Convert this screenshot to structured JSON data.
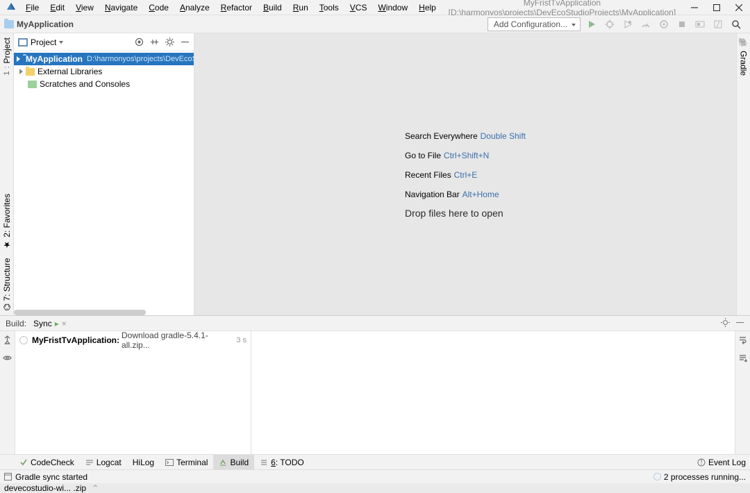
{
  "menubar": {
    "items": [
      "File",
      "Edit",
      "View",
      "Navigate",
      "Code",
      "Analyze",
      "Refactor",
      "Build",
      "Run",
      "Tools",
      "VCS",
      "Window",
      "Help"
    ],
    "title": "MyFristTvApplication [D:\\harmonyos\\projects\\DevEcoStudioProjects\\MyApplication]"
  },
  "navbar": {
    "name": "MyApplication",
    "addConfig": "Add Configuration..."
  },
  "leftStrip": {
    "label": "Project",
    "num": "1"
  },
  "rightStrip": {
    "label": "Gradle"
  },
  "sidebar": {
    "head": "Project",
    "items": [
      {
        "name": "MyApplication",
        "path": "D:\\harmonyos\\projects\\DevEcoStudioProjects\\MyApplication",
        "selected": true
      },
      {
        "name": "External Libraries"
      },
      {
        "name": "Scratches and Consoles"
      }
    ]
  },
  "welcome": {
    "l1a": "Search Everywhere",
    "l1b": "Double Shift",
    "l2a": "Go to File",
    "l2b": "Ctrl+Shift+N",
    "l3a": "Recent Files",
    "l3b": "Ctrl+E",
    "l4a": "Navigation Bar",
    "l4b": "Alt+Home",
    "l5": "Drop files here to open"
  },
  "build": {
    "title": "Build:",
    "tab": "Sync",
    "rowName": "MyFristTvApplication:",
    "rowDesc": "Download gradle-5.4.1-all.zip...",
    "rowTime": "3 s"
  },
  "toolstrip": {
    "items": [
      {
        "num": "",
        "label": "CodeCheck"
      },
      {
        "num": "",
        "label": "Logcat"
      },
      {
        "num": "",
        "label": "HiLog"
      },
      {
        "num": "",
        "label": "Terminal"
      },
      {
        "num": "",
        "label": "Build",
        "selected": true
      },
      {
        "num": "6",
        "label": "TODO"
      }
    ],
    "event": "Event Log"
  },
  "leftTabsBottom": {
    "fav": "2: Favorites",
    "struct": "7: Structure"
  },
  "statusbar": {
    "msg": "Gradle sync started",
    "procs": "2 processes running..."
  },
  "desk": {
    "file": "devecostudio-wi... .zip"
  }
}
